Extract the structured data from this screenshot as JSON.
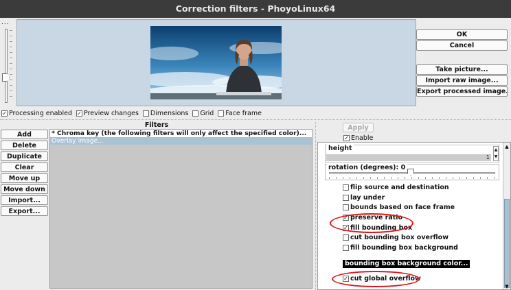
{
  "window": {
    "title": "Correction filters - PhoyoLinux64"
  },
  "zoom_slider": {
    "label": "..."
  },
  "actions": {
    "ok": "OK",
    "cancel": "Cancel",
    "take_picture": "Take picture...",
    "import_raw": "Import raw image...",
    "export_processed": "Export processed image..."
  },
  "preview_options": [
    {
      "label": "Processing enabled",
      "checked": true
    },
    {
      "label": "Preview changes",
      "checked": true
    },
    {
      "label": "Dimensions",
      "checked": false
    },
    {
      "label": "Grid",
      "checked": false
    },
    {
      "label": "Face frame",
      "checked": false
    }
  ],
  "filters": {
    "title": "Filters",
    "buttons": [
      "Add",
      "Delete",
      "Duplicate",
      "Clear",
      "Move up",
      "Move down",
      "Import...",
      "Export..."
    ],
    "items": [
      "* Chroma key (the following filters will only affect the specified color)...",
      "Overlay image..."
    ],
    "selected_index": 1
  },
  "properties": {
    "apply": "Apply",
    "enable": {
      "label": "Enable",
      "checked": true
    },
    "height": {
      "label": "height",
      "value": "1"
    },
    "rotation": {
      "label": "rotation (degrees): 0",
      "value": 0
    },
    "checkboxes": [
      {
        "label": "flip source and destination",
        "checked": false
      },
      {
        "label": "lay under",
        "checked": false
      },
      {
        "label": "bounds based on face frame",
        "checked": false
      },
      {
        "label": "preserve ratio",
        "checked": true
      },
      {
        "label": "fill bounding box",
        "checked": true
      },
      {
        "label": "cut bounding box overflow",
        "checked": false
      },
      {
        "label": "fill bounding box background",
        "checked": false
      }
    ],
    "color_button": "bounding box background color...",
    "cut_global_overflow": {
      "label": "cut global overflow",
      "checked": true
    }
  },
  "colors": {
    "annotation": "#e0141a",
    "preview_bg": "#c9d7e4",
    "selection": "#a9c3d4"
  }
}
